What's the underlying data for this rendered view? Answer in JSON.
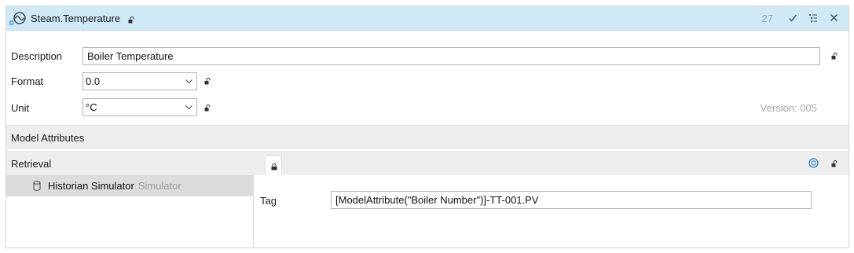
{
  "window": {
    "title": "Steam.Temperature",
    "count": "27",
    "check_icon": "checkmark-icon",
    "tree_icon": "tree-list-icon",
    "close_icon": "close-icon",
    "signal_icon": "signal-wave-icon"
  },
  "fields": {
    "description": {
      "label": "Description",
      "value": "Boiler Temperature"
    },
    "format": {
      "label": "Format",
      "value": "0.0"
    },
    "unit": {
      "label": "Unit",
      "value": "°C"
    },
    "version": "Version: 005"
  },
  "sections": {
    "model_attributes": "Model Attributes",
    "retrieval": "Retrieval"
  },
  "retrieval": {
    "source_name": "Historian Simulator",
    "source_type": "Simulator",
    "tag_label": "Tag",
    "tag_value": "[ModelAttribute(\"Boiler Number\")]-TT-001.PV"
  },
  "colors": {
    "titlebar": "#cfe9f7",
    "section": "#ededed",
    "selected_row": "#dcdcdc",
    "accent": "#1a7fc1"
  }
}
